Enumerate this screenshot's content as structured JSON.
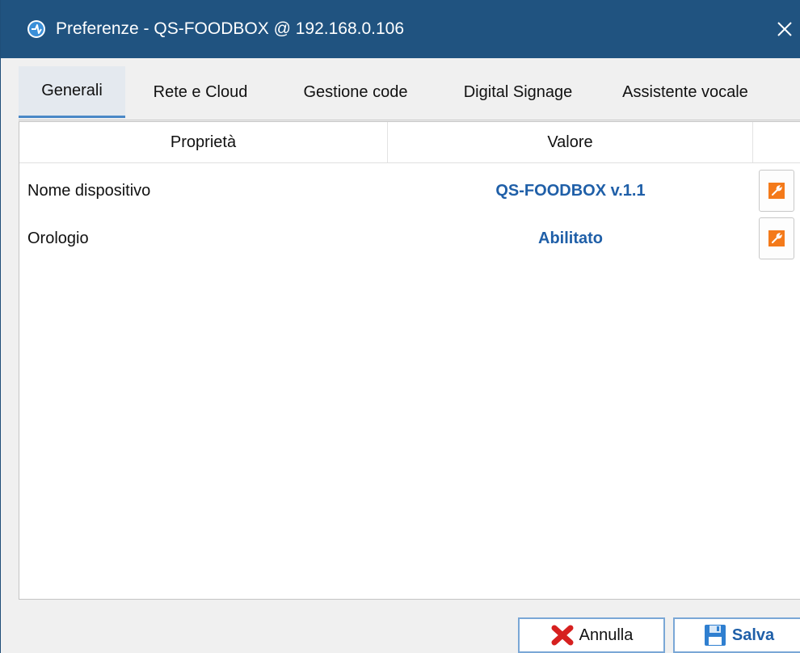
{
  "window": {
    "title": "Preferenze - QS-FOODBOX @ 192.168.0.106",
    "icon": "app-logo-icon",
    "close_symbol": "✕",
    "titlebar_color": "#205380"
  },
  "tabs": [
    {
      "label": "Generali",
      "active": true
    },
    {
      "label": "Rete e Cloud",
      "active": false
    },
    {
      "label": "Gestione code",
      "active": false
    },
    {
      "label": "Digital Signage",
      "active": false
    },
    {
      "label": "Assistente vocale",
      "active": false
    }
  ],
  "grid": {
    "columns": {
      "property": "Proprietà",
      "value": "Valore",
      "action": ""
    },
    "rows": [
      {
        "property": "Nome dispositivo",
        "value": "QS-FOODBOX v.1.1",
        "action_icon": "wrench-icon"
      },
      {
        "property": "Orologio",
        "value": "Abilitato",
        "action_icon": "wrench-icon"
      }
    ],
    "value_color": "#1f5fa8",
    "action_color": "#f47a1a"
  },
  "footer": {
    "cancel_label": "Annulla",
    "cancel_icon": "red-x-icon",
    "save_label": "Salva",
    "save_icon": "floppy-disk-icon"
  }
}
